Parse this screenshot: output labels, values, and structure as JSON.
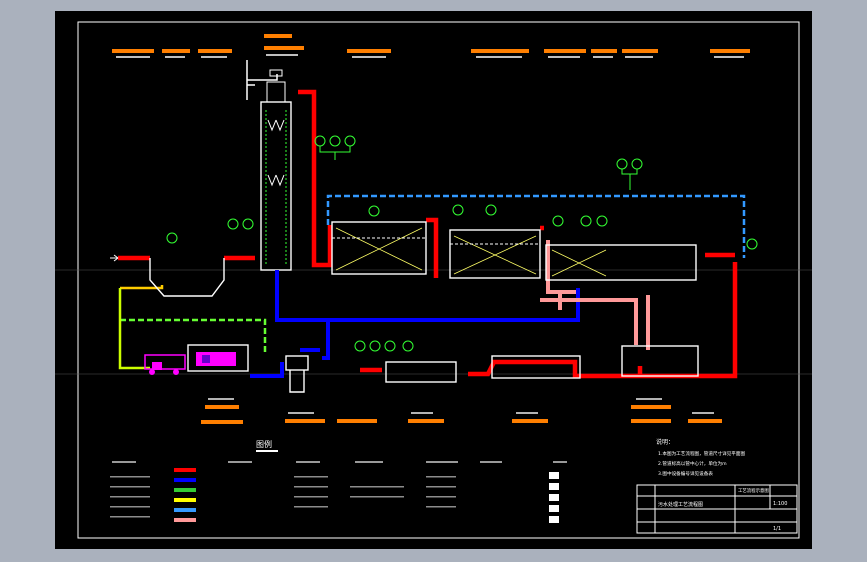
{
  "legend": {
    "title": "图例"
  },
  "notes": {
    "title": "说明：",
    "lines": [
      "1.本图为工艺流程图，管道尺寸详见平面图",
      "2.管道标高以管中心计，单位为m",
      "3.图中设备编号详见设备表"
    ]
  },
  "title_block": {
    "project": "工艺流程示意图",
    "drawing_name": "污水处理工艺流程图",
    "scale": "1:100",
    "sheet": "1/1"
  },
  "colors": {
    "frame_bg": "#000000",
    "outer_bg": "#aab1bd",
    "sludge_pipe": "#ff0000",
    "return_pipe": "#0000ff",
    "air_pipe": "#3399ff",
    "reuse_pipe": "#33cc33",
    "dosing_pipe": "#ffcc00",
    "pink_pipe": "#ff9999",
    "label_bar": "#ff7f00",
    "instrument": "#33ff33",
    "equipment": "#ff00ff"
  },
  "icons": {
    "instrument": "instrument-bubble-icon",
    "truck": "sludge-truck-icon",
    "valve": "valve-icon"
  }
}
